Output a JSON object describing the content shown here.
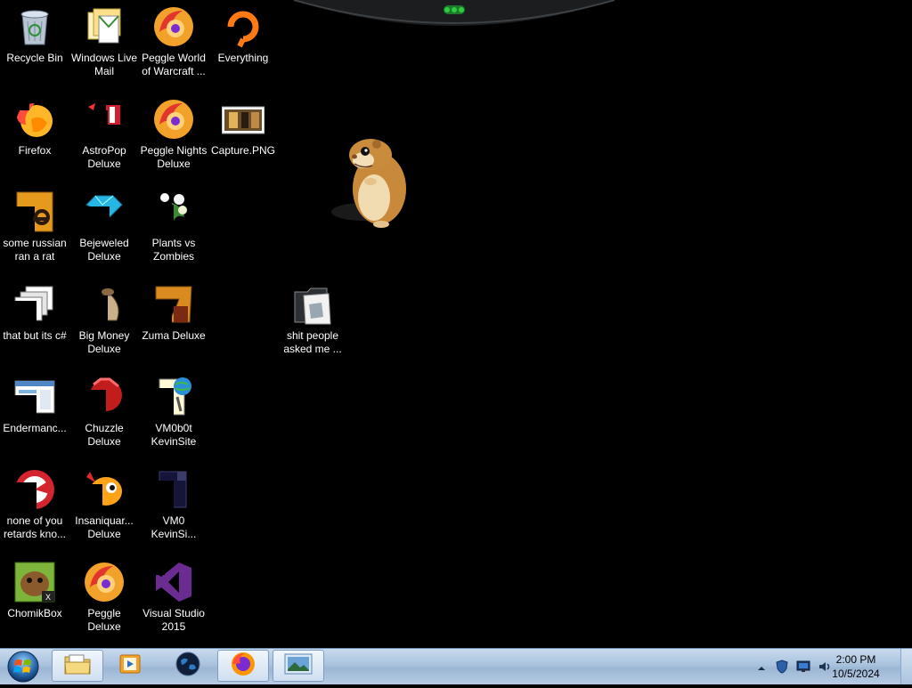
{
  "desktop": {
    "icons": [
      {
        "id": "recycle-bin",
        "label": "Recycle Bin",
        "icon": "recycle-bin-icon"
      },
      {
        "id": "windows-live-mail",
        "label": "Windows Live\nMail",
        "icon": "mail-icon"
      },
      {
        "id": "peggle-world-of-warcraft",
        "label": "Peggle World\nof Warcraft ...",
        "icon": "peggle-icon"
      },
      {
        "id": "everything",
        "label": "Everything",
        "icon": "search-icon"
      },
      {
        "id": "firefox",
        "label": "Firefox",
        "icon": "firefox-icon"
      },
      {
        "id": "astropop-deluxe",
        "label": "AstroPop\nDeluxe",
        "icon": "astropop-icon"
      },
      {
        "id": "peggle-nights-deluxe",
        "label": "Peggle Nights\nDeluxe",
        "icon": "peggle-icon"
      },
      {
        "id": "capture-png",
        "label": "Capture.PNG",
        "icon": "image-file-icon"
      },
      {
        "id": "some-russian-ran-a-rat",
        "label": "some russian\nran a rat",
        "icon": "document-icon"
      },
      {
        "id": "bejeweled-deluxe",
        "label": "Bejeweled\nDeluxe",
        "icon": "gem-icon"
      },
      {
        "id": "plants-vs-zombies",
        "label": "Plants vs\nZombies",
        "icon": "plant-icon"
      },
      {
        "id": "that-but-its-csharp",
        "label": "that but its c#",
        "icon": "shortcut-icon"
      },
      {
        "id": "big-money-deluxe",
        "label": "Big Money\nDeluxe",
        "icon": "money-bag-icon"
      },
      {
        "id": "zuma-deluxe",
        "label": "Zuma Deluxe",
        "icon": "zuma-icon"
      },
      {
        "id": "shit-people-asked-me",
        "label": "shit people\nasked me ...",
        "icon": "folder-icon"
      },
      {
        "id": "endermanch",
        "label": "Endermanc...",
        "icon": "window-icon"
      },
      {
        "id": "chuzzle-deluxe",
        "label": "Chuzzle\nDeluxe",
        "icon": "chuzzle-icon"
      },
      {
        "id": "vm0b0t-kevinsite",
        "label": "VM0b0t\nKevinSite",
        "icon": "web-document-icon"
      },
      {
        "id": "none-of-you-retards-know",
        "label": "none of you\nretards kno...",
        "icon": "red-app-icon"
      },
      {
        "id": "insaniquarium-deluxe",
        "label": "Insaniquar...\nDeluxe",
        "icon": "fish-icon"
      },
      {
        "id": "vm0-kevinsite",
        "label": "VM0\nKevinSi...",
        "icon": "dark-document-icon"
      },
      {
        "id": "chomikbox",
        "label": "ChomikBox",
        "icon": "hamster-app-icon"
      },
      {
        "id": "peggle-deluxe",
        "label": "Peggle Deluxe",
        "icon": "peggle-icon"
      },
      {
        "id": "visual-studio-2015",
        "label": "Visual Studio\n2015",
        "icon": "visual-studio-icon"
      }
    ],
    "gadget": {
      "icon": "top-gadget-icon"
    },
    "mascot": {
      "icon": "hamster-icon"
    }
  },
  "taskbar": {
    "start_icon": "windows-start-icon",
    "pinned": [
      {
        "id": "explorer",
        "icon": "folder-explorer-icon",
        "active": true
      },
      {
        "id": "media",
        "icon": "media-player-icon",
        "active": false
      },
      {
        "id": "globe",
        "icon": "globe-icon",
        "active": false
      },
      {
        "id": "firefox",
        "icon": "firefox-icon",
        "active": true
      },
      {
        "id": "photos",
        "icon": "photo-viewer-icon",
        "active": true
      }
    ],
    "tray": {
      "chevron_icon": "show-hidden-icons-icon",
      "icons": [
        "shield-icon",
        "network-monitor-icon",
        "volume-icon"
      ],
      "time": "2:00 PM",
      "date": "10/5/2024"
    }
  },
  "colors": {
    "taskbar_top": "#c9dbee",
    "taskbar_bottom": "#9bb6d4",
    "desktop": "#000000"
  }
}
